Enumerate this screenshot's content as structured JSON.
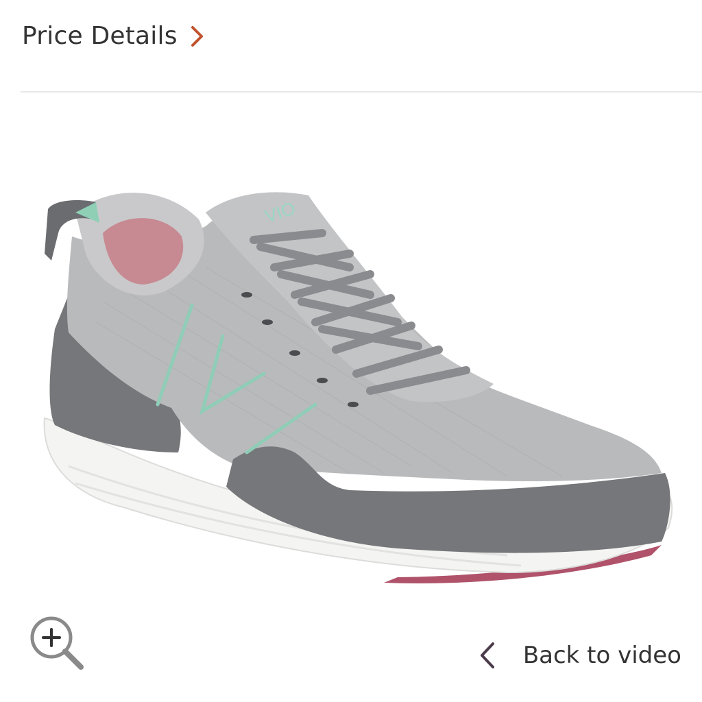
{
  "header": {
    "price_details_label": "Price Details",
    "chevron_color": "#c0522d"
  },
  "product": {
    "image_icon": "sneaker-image",
    "brand_mark": "VIO"
  },
  "controls": {
    "zoom_icon": "zoom-in-icon",
    "back_label": "Back to video",
    "back_icon": "chevron-left-icon",
    "back_chevron_color": "#4a3a4a"
  }
}
